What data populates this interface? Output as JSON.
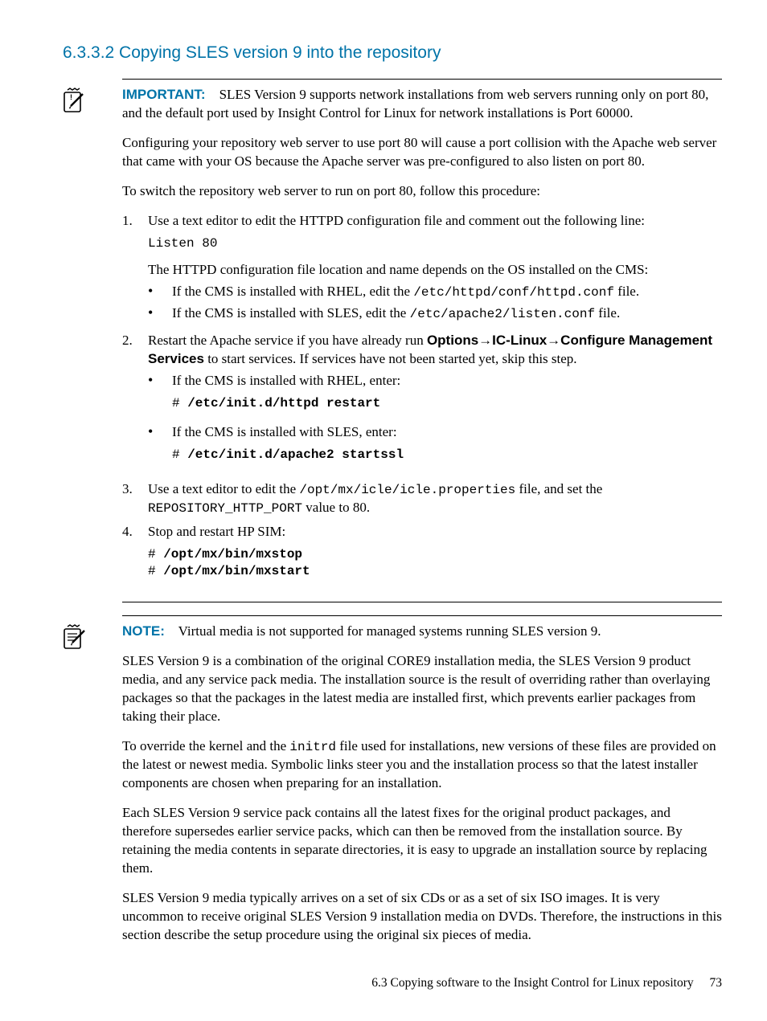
{
  "heading": "6.3.3.2 Copying SLES version 9 into the repository",
  "important": {
    "label": "IMPORTANT:",
    "p1": "SLES Version 9 supports network installations from web servers running only on port 80, and the default port used by Insight Control for Linux for network installations is Port 60000.",
    "p2": "Configuring your repository web server to use port 80 will cause a port collision with the Apache web server that came with your OS because the Apache server was pre-configured to also listen on port 80.",
    "p3": "To switch the repository web server to run on port 80, follow this procedure:"
  },
  "steps": {
    "s1": {
      "num": "1.",
      "text": "Use a text editor to edit the HTTPD configuration file and comment out the following line:",
      "code": "Listen 80",
      "after": "The HTTPD configuration file location and name depends on the OS installed on the CMS:",
      "b1_pre": "If the CMS is installed with RHEL, edit the ",
      "b1_code": "/etc/httpd/conf/httpd.conf",
      "b1_post": " file.",
      "b2_pre": "If the CMS is installed with SLES, edit the ",
      "b2_code": "/etc/apache2/listen.conf",
      "b2_post": " file."
    },
    "s2": {
      "num": "2.",
      "pre": "Restart the Apache service if you have already run ",
      "opt": "Options",
      "ic": "IC-Linux",
      "conf": "Configure Management Services",
      "post": " to start services. If services have not been started yet, skip this step.",
      "b1": "If the CMS is installed with RHEL, enter:",
      "b1_code": "/etc/init.d/httpd restart",
      "b2": "If the CMS is installed with SLES, enter:",
      "b2_code": "/etc/init.d/apache2 startssl"
    },
    "s3": {
      "num": "3.",
      "pre": "Use a text editor to edit the ",
      "code1": "/opt/mx/icle/icle.properties",
      "mid": " file, and set the ",
      "code2": "REPOSITORY_HTTP_PORT",
      "post": " value to 80."
    },
    "s4": {
      "num": "4.",
      "text": "Stop and restart HP SIM:",
      "c1": "/opt/mx/bin/mxstop",
      "c2": "/opt/mx/bin/mxstart"
    }
  },
  "note": {
    "label": "NOTE:",
    "text": "Virtual media is not supported for managed systems running SLES version 9.",
    "p1": "SLES Version 9 is a combination of the original CORE9 installation media, the SLES Version 9 product media, and any service pack media. The installation source is the result of overriding rather than overlaying packages so that the packages in the latest media are installed first, which prevents earlier packages from taking their place.",
    "p2_pre": "To override the kernel and the ",
    "p2_code": "initrd",
    "p2_post": " file used for installations, new versions of these files are provided on the latest or newest media. Symbolic links steer you and the installation process so that the latest installer components are chosen when preparing for an installation.",
    "p3": "Each SLES Version 9 service pack contains all the latest fixes for the original product packages, and therefore supersedes earlier service packs, which can then be removed from the installation source. By retaining the media contents in separate directories, it is easy to upgrade an installation source by replacing them.",
    "p4": "SLES Version 9 media typically arrives on a set of six CDs or as a set of six ISO images. It is very uncommon to receive original SLES Version 9 installation media on DVDs. Therefore, the instructions in this section describe the setup procedure using the original six pieces of media."
  },
  "footer": {
    "text": "6.3 Copying software to the Insight Control for Linux repository",
    "page": "73"
  },
  "hash": "# "
}
